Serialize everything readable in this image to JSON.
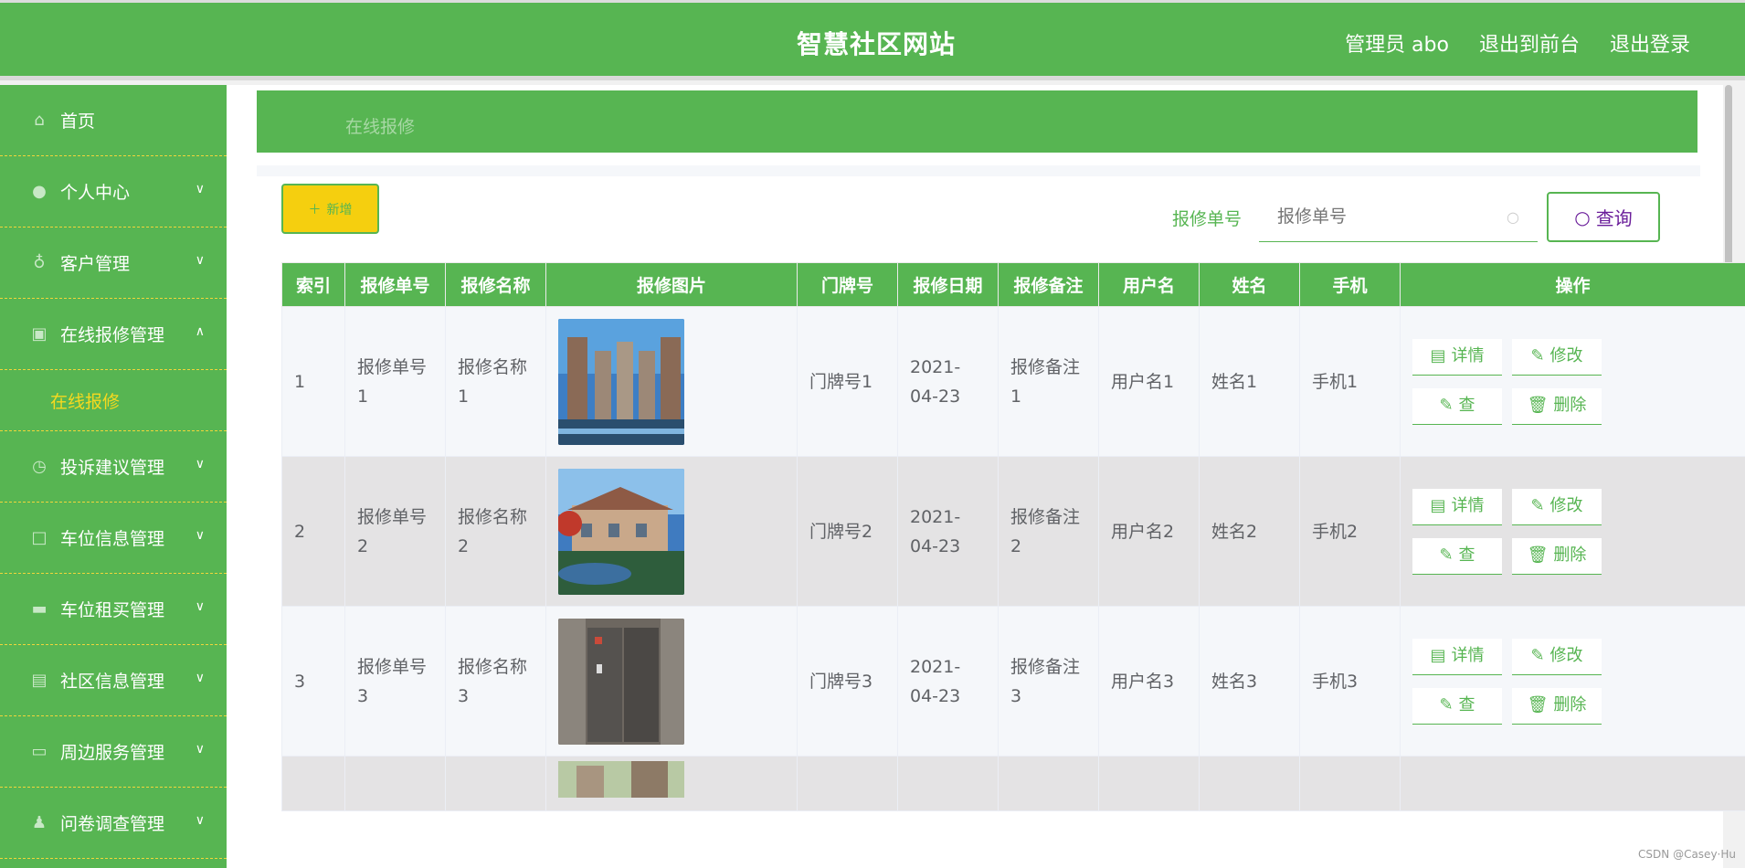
{
  "header": {
    "title": "智慧社区网站",
    "admin_label": "管理员 abo",
    "back_label": "退出到前台",
    "logout_label": "退出登录"
  },
  "sidebar": {
    "items": [
      {
        "label": "首页",
        "icon": "home-icon"
      },
      {
        "label": "个人中心",
        "icon": "user-icon"
      },
      {
        "label": "客户管理",
        "icon": "bulb-icon"
      },
      {
        "label": "在线报修管理",
        "icon": "briefcase-icon"
      },
      {
        "label": "投诉建议管理",
        "icon": "clock-icon"
      },
      {
        "label": "车位信息管理",
        "icon": "square-icon"
      },
      {
        "label": "车位租买管理",
        "icon": "car-icon"
      },
      {
        "label": "社区信息管理",
        "icon": "card-icon"
      },
      {
        "label": "周边服务管理",
        "icon": "monitor-icon"
      },
      {
        "label": "问卷调查管理",
        "icon": "person-icon"
      }
    ],
    "sub_item": "在线报修"
  },
  "breadcrumb": {
    "current": "在线报修"
  },
  "search": {
    "label": "报修单号",
    "placeholder": "报修单号",
    "button": "查询"
  },
  "add_button": "新增",
  "table": {
    "headers": [
      "索引",
      "报修单号",
      "报修名称",
      "报修图片",
      "门牌号",
      "报修日期",
      "报修备注",
      "用户名",
      "姓名",
      "手机",
      "操作"
    ],
    "rows": [
      {
        "index": "1",
        "no": "报修单号1",
        "name": "报修名称1",
        "door": "门牌号1",
        "date": "2021-04-23",
        "note": "报修备注1",
        "user": "用户名1",
        "fullname": "姓名1",
        "phone": "手机1"
      },
      {
        "index": "2",
        "no": "报修单号2",
        "name": "报修名称2",
        "door": "门牌号2",
        "date": "2021-04-23",
        "note": "报修备注2",
        "user": "用户名2",
        "fullname": "姓名2",
        "phone": "手机2"
      },
      {
        "index": "3",
        "no": "报修单号3",
        "name": "报修名称3",
        "door": "门牌号3",
        "date": "2021-04-23",
        "note": "报修备注3",
        "user": "用户名3",
        "fullname": "姓名3",
        "phone": "手机3"
      }
    ],
    "ops": {
      "detail": "详情",
      "edit": "修改",
      "view": "查",
      "delete": "删除"
    }
  },
  "watermark": "CSDN @Casey·Hu",
  "colors": {
    "primary": "#57b552",
    "accent": "#f5cf0f",
    "sub_active": "#f6d91f"
  }
}
